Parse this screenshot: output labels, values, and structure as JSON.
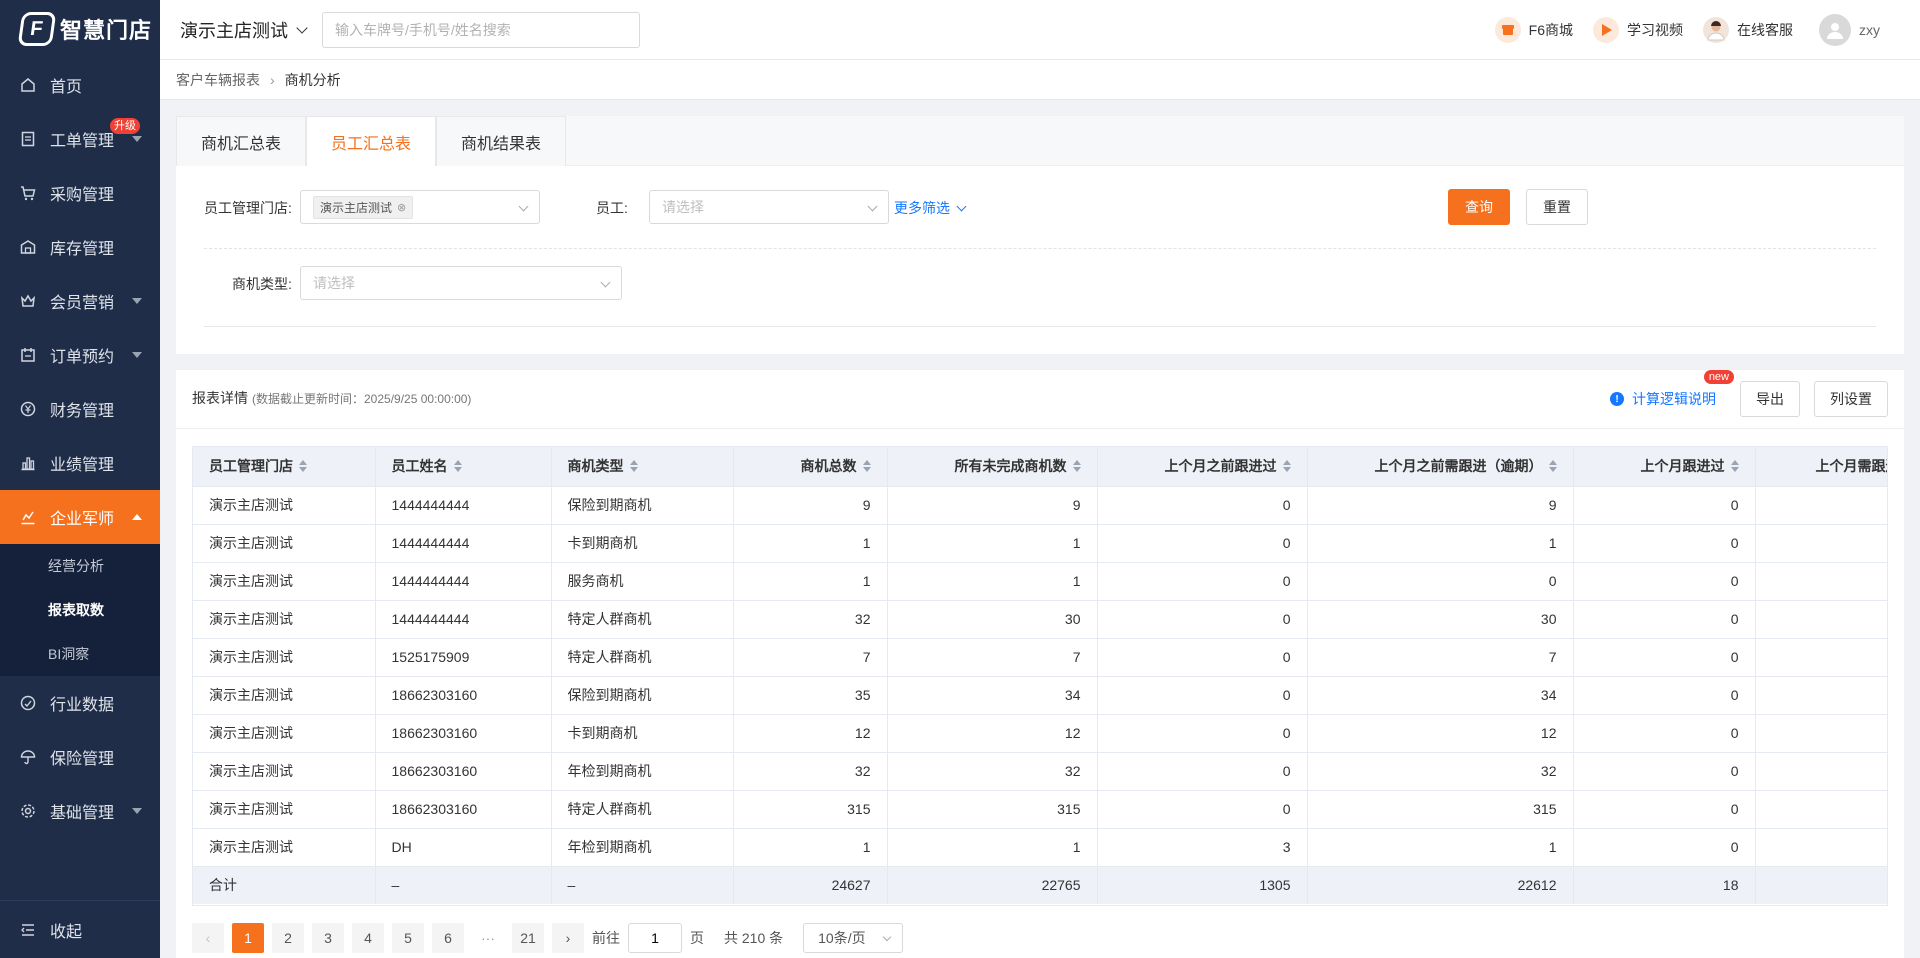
{
  "app": {
    "logo_text": "智慧门店"
  },
  "sidebar": {
    "items": [
      {
        "label": "首页",
        "icon": "home-icon"
      },
      {
        "label": "工单管理",
        "icon": "document-icon",
        "badge": "升级"
      },
      {
        "label": "采购管理",
        "icon": "cart-icon"
      },
      {
        "label": "库存管理",
        "icon": "warehouse-icon"
      },
      {
        "label": "会员营销",
        "icon": "crown-icon"
      },
      {
        "label": "订单预约",
        "icon": "calendar-icon"
      },
      {
        "label": "财务管理",
        "icon": "yen-icon"
      },
      {
        "label": "业绩管理",
        "icon": "bar-chart-icon"
      },
      {
        "label": "企业军师",
        "icon": "trend-icon"
      },
      {
        "label": "行业数据",
        "icon": "gauge-icon"
      },
      {
        "label": "保险管理",
        "icon": "umbrella-icon"
      },
      {
        "label": "基础管理",
        "icon": "gear-icon"
      }
    ],
    "sub_items": [
      {
        "label": "经营分析"
      },
      {
        "label": "报表取数"
      },
      {
        "label": "BI洞察"
      }
    ],
    "collapse_label": "收起"
  },
  "header": {
    "store_name": "演示主店测试",
    "search_placeholder": "输入车牌号/手机号/姓名搜索",
    "links": [
      {
        "label": "F6商城"
      },
      {
        "label": "学习视频"
      },
      {
        "label": "在线客服"
      }
    ],
    "user": "zxy"
  },
  "breadcrumb": {
    "parent": "客户车辆报表",
    "current": "商机分析"
  },
  "tabs": [
    {
      "label": "商机汇总表"
    },
    {
      "label": "员工汇总表"
    },
    {
      "label": "商机结果表"
    }
  ],
  "filters": {
    "store_label": "员工管理门店:",
    "store_tag": "演示主店测试",
    "employee_label": "员工:",
    "employee_placeholder": "请选择",
    "more_filters": "更多筛选",
    "type_label": "商机类型:",
    "type_placeholder": "请选择",
    "query_button": "查询",
    "reset_button": "重置"
  },
  "report": {
    "title": "报表详情",
    "subtitle": "(数据截止更新时间：2025/9/25 00:00:00)",
    "calc_link": "计算逻辑说明",
    "new_badge": "new",
    "export_button": "导出",
    "columns_button": "列设置"
  },
  "table": {
    "headers": [
      "员工管理门店",
      "员工姓名",
      "商机类型",
      "商机总数",
      "所有未完成商机数",
      "上个月之前跟进过",
      "上个月之前需跟进（逾期）",
      "上个月跟进过",
      "上个月需跟进"
    ],
    "rows": [
      [
        "演示主店测试",
        "1444444444",
        "保险到期商机",
        "9",
        "9",
        "0",
        "9",
        "0",
        ""
      ],
      [
        "演示主店测试",
        "1444444444",
        "卡到期商机",
        "1",
        "1",
        "0",
        "1",
        "0",
        ""
      ],
      [
        "演示主店测试",
        "1444444444",
        "服务商机",
        "1",
        "1",
        "0",
        "0",
        "0",
        ""
      ],
      [
        "演示主店测试",
        "1444444444",
        "特定人群商机",
        "32",
        "30",
        "0",
        "30",
        "0",
        ""
      ],
      [
        "演示主店测试",
        "1525175909",
        "特定人群商机",
        "7",
        "7",
        "0",
        "7",
        "0",
        ""
      ],
      [
        "演示主店测试",
        "18662303160",
        "保险到期商机",
        "35",
        "34",
        "0",
        "34",
        "0",
        ""
      ],
      [
        "演示主店测试",
        "18662303160",
        "卡到期商机",
        "12",
        "12",
        "0",
        "12",
        "0",
        ""
      ],
      [
        "演示主店测试",
        "18662303160",
        "年检到期商机",
        "32",
        "32",
        "0",
        "32",
        "0",
        ""
      ],
      [
        "演示主店测试",
        "18662303160",
        "特定人群商机",
        "315",
        "315",
        "0",
        "315",
        "0",
        ""
      ],
      [
        "演示主店测试",
        "DH",
        "年检到期商机",
        "1",
        "1",
        "3",
        "1",
        "0",
        ""
      ]
    ],
    "total": [
      "合计",
      "–",
      "–",
      "24627",
      "22765",
      "1305",
      "22612",
      "18",
      ""
    ]
  },
  "pagination": {
    "pages": [
      "1",
      "2",
      "3",
      "4",
      "5",
      "6",
      "···",
      "21"
    ],
    "current": "1",
    "goto_label": "前往",
    "goto_value": "1",
    "page_unit": "页",
    "total_text": "共 210 条",
    "page_size": "10条/页"
  },
  "colors": {
    "accent": "#f5711d",
    "sidebar_bg": "#1f2d48",
    "link": "#1677ff"
  }
}
